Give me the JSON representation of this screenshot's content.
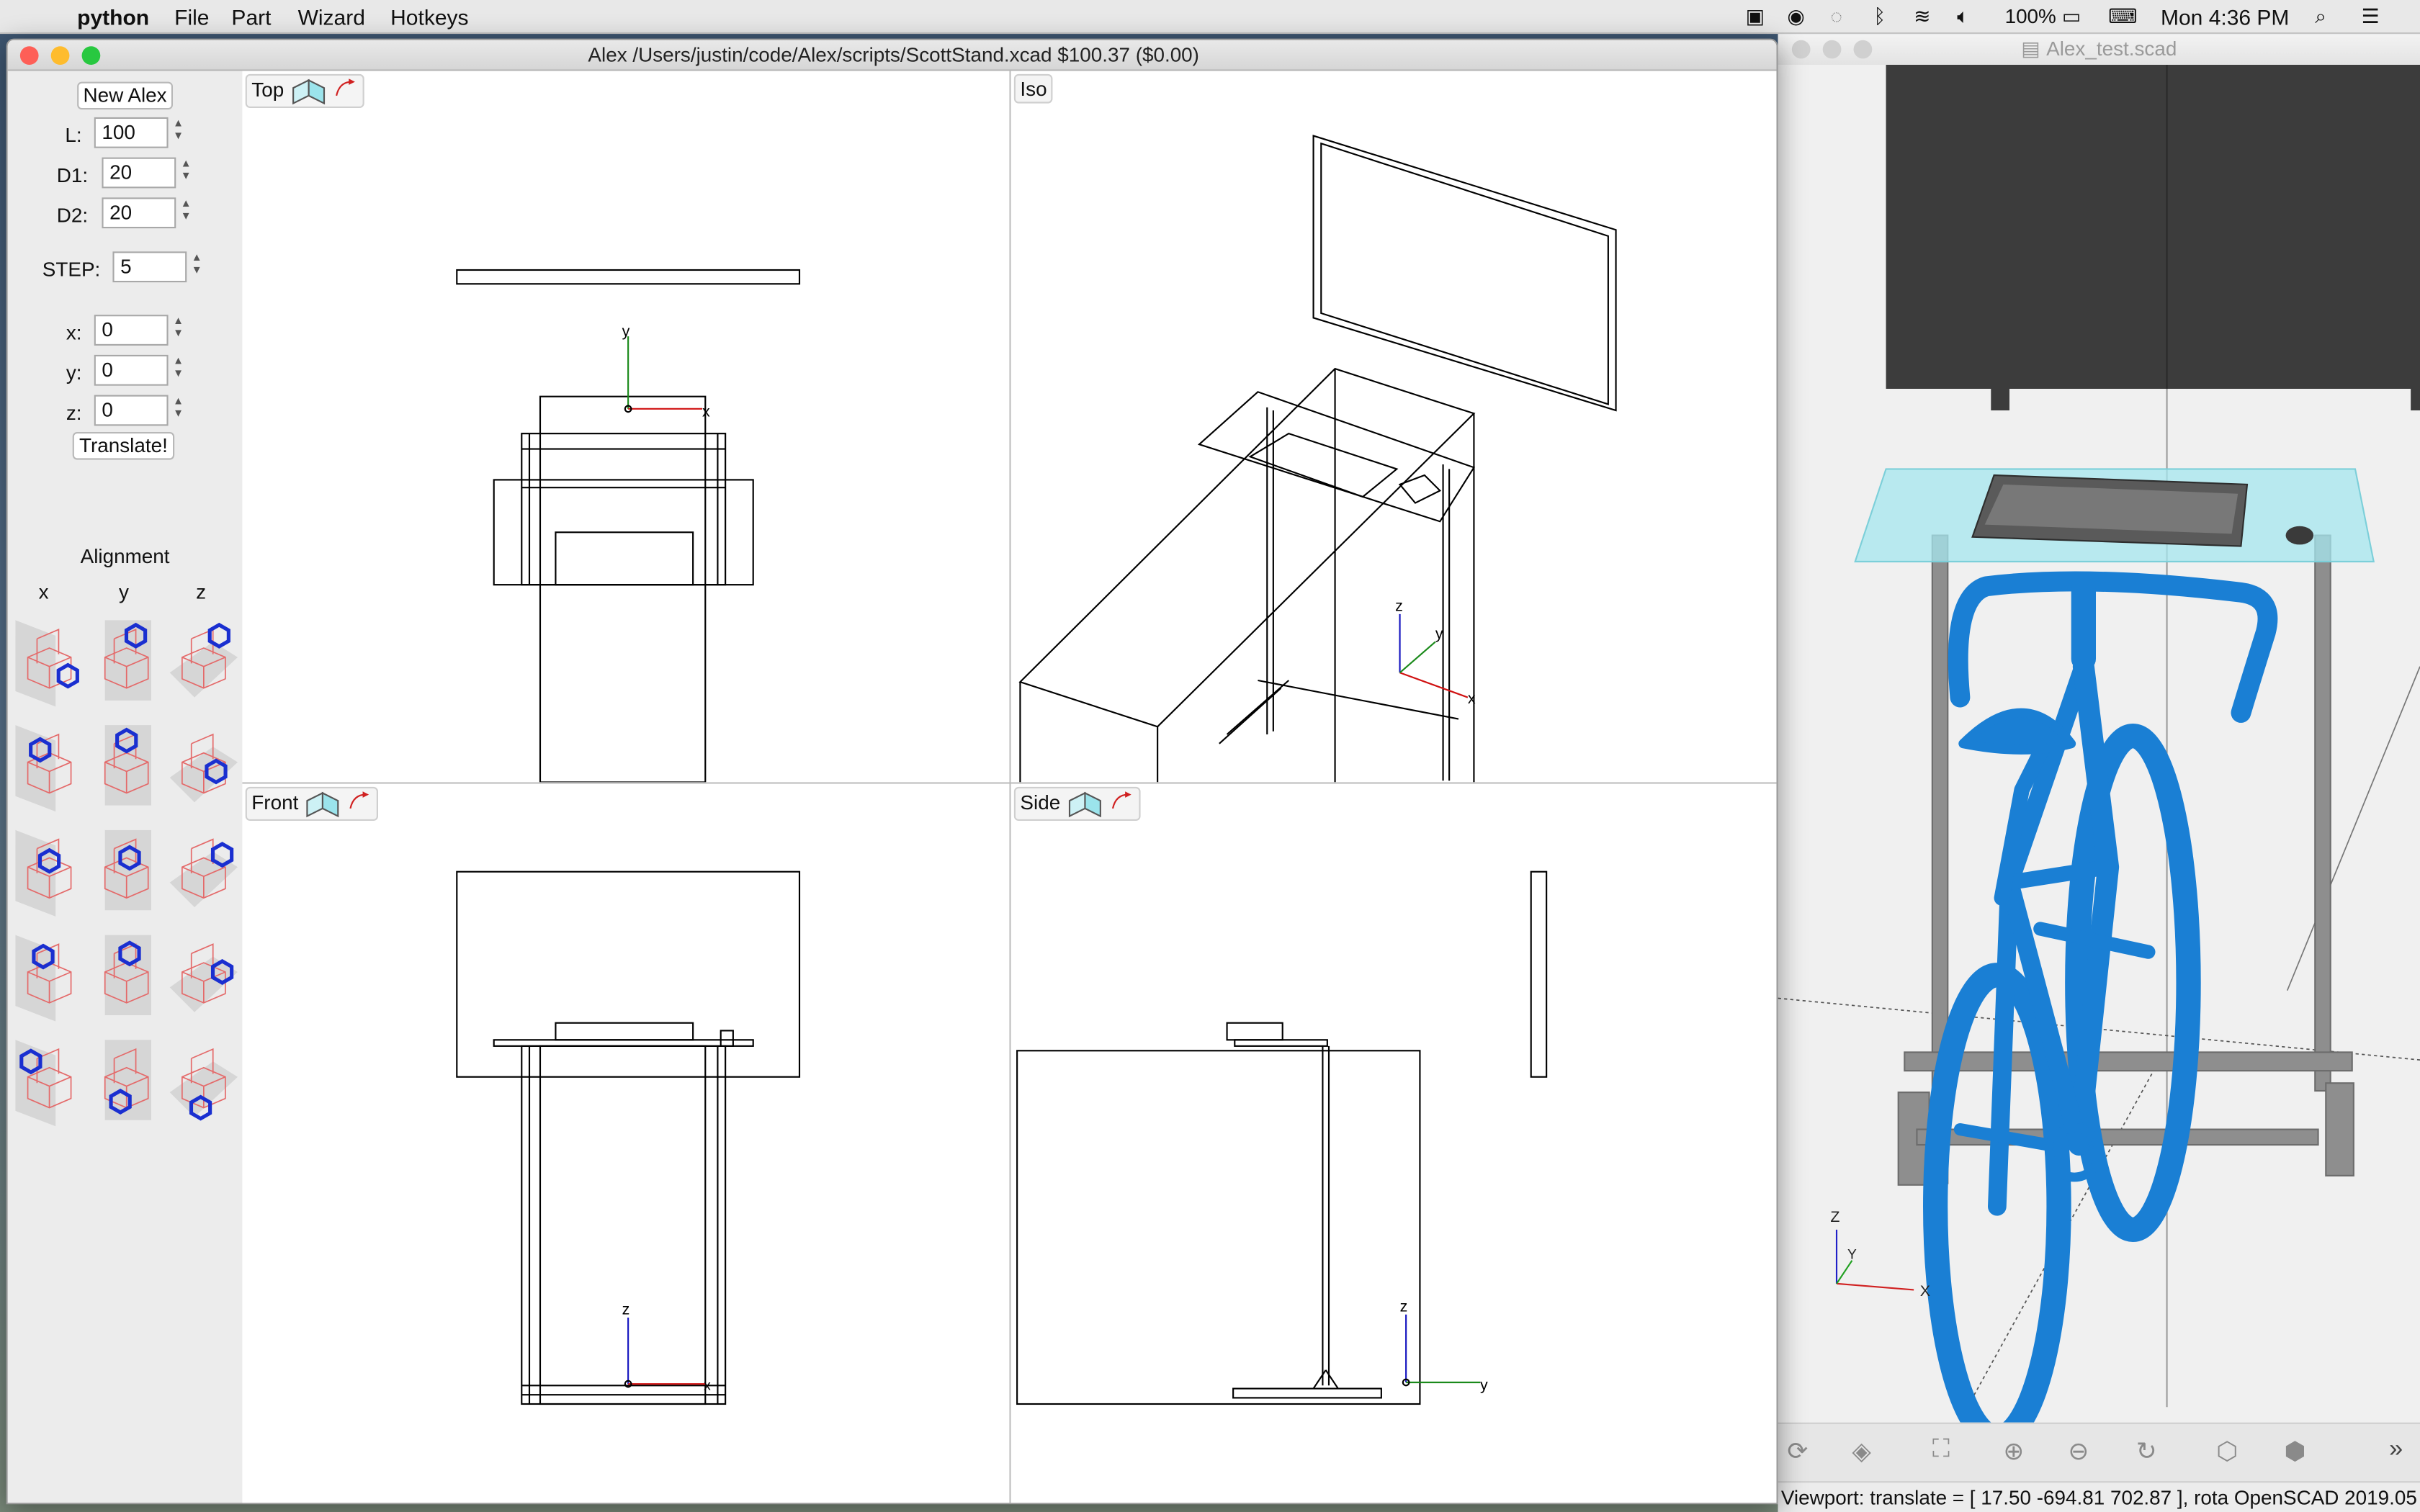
{
  "menubar": {
    "app": "python",
    "menus": [
      "File",
      "Part",
      "Wizard",
      "Hotkeys"
    ],
    "battery": "100%",
    "clock": "Mon 4:36 PM"
  },
  "main_window": {
    "title": "Alex /Users/justin/code/Alex/scripts/ScottStand.xcad $100.37 ($0.00)"
  },
  "panel": {
    "new_button": "New Alex",
    "fields": [
      {
        "label": "L:",
        "value": "100"
      },
      {
        "label": "D1:",
        "value": "20"
      },
      {
        "label": "D2:",
        "value": "20"
      },
      {
        "label": "STEP:",
        "value": "5"
      },
      {
        "label": "x:",
        "value": "0"
      },
      {
        "label": "y:",
        "value": "0"
      },
      {
        "label": "z:",
        "value": "0"
      }
    ],
    "translate_button": "Translate!",
    "alignment_title": "Alignment",
    "alignment_cols": [
      "x",
      "y",
      "z"
    ]
  },
  "views": {
    "top": {
      "label": "Top",
      "axes": [
        "y",
        "x"
      ]
    },
    "iso": {
      "label": "Iso",
      "axes": [
        "z",
        "y",
        "x"
      ]
    },
    "front": {
      "label": "Front",
      "axes": [
        "z",
        "x"
      ]
    },
    "side": {
      "label": "Side",
      "axes": [
        "z",
        "y"
      ]
    }
  },
  "openscad": {
    "title": "Alex_test.scad",
    "status": "Viewport: translate = [ 17.50 -694.81 702.87 ], rota OpenSCAD 2019.05",
    "axes": [
      "Z",
      "Y",
      "X"
    ]
  },
  "colors": {
    "menubar_bg": "#e8e8e8",
    "window_bg": "#ececec",
    "bike_blue": "#1a7fd4",
    "glass_cyan": "#a6e7ef",
    "cabinet": "#3a3a3a",
    "close": "#fe5f57",
    "minimize": "#febc2e",
    "zoom": "#28c840"
  }
}
